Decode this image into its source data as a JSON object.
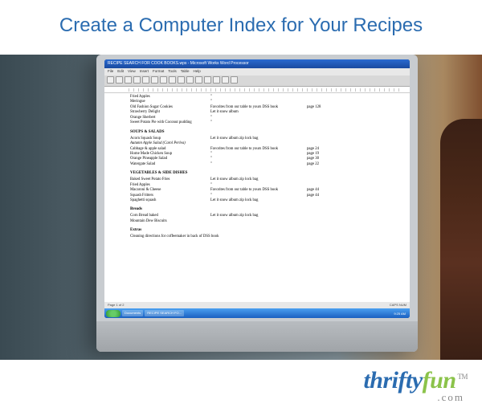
{
  "page": {
    "title": "Create a Computer Index for Your Recipes"
  },
  "logo": {
    "part1": "thrifty",
    "part2": "fun",
    "tm": "TM",
    "domain": ".com"
  },
  "word": {
    "titlebar": "RECIPE SEARCH FOR COOK BOOKS.wps - Microsoft Works Word Processor",
    "menus": [
      "File",
      "Edit",
      "View",
      "Insert",
      "Format",
      "Tools",
      "Table",
      "Help"
    ],
    "status_left": "Page 1 of 2",
    "status_right": "CAPS NUM",
    "taskbar": {
      "doc_item": "Documents",
      "app_item": "RECIPE SEARCH FO...",
      "clock": "9:25 AM"
    }
  },
  "doc": {
    "top_rows": [
      {
        "name": "Fried Apples",
        "src": "\"",
        "pg": ""
      },
      {
        "name": "Meringue",
        "src": "\"",
        "pg": ""
      },
      {
        "name": "Old Fashion Sugar Cookies",
        "src": "Favorites from our table to yours DSS book",
        "pg": "page 128"
      },
      {
        "name": "Strawberry Delight",
        "src": "Let it snow album",
        "pg": ""
      },
      {
        "name": "Orange Sherbert",
        "src": "\"",
        "pg": ""
      },
      {
        "name": "Sweet Potato Pie with Coconut pudding",
        "src": "\"",
        "pg": ""
      }
    ],
    "sections": [
      {
        "head": "SOUPS & SALADS",
        "rows": [
          {
            "name": "Acorn Squash Soup",
            "src": "Let it snow album zip lock bag",
            "pg": ""
          },
          {
            "name": "Autumn Apple Salad  (Carol Perlea)",
            "ital": true,
            "src": "",
            "pg": ""
          },
          {
            "name": "Cabbage & apple salad",
            "src": "Favorites from our table to yours DSS book",
            "pg": "page 24"
          },
          {
            "name": "Home Made Chicken Soup",
            "src": "\"",
            "pg": "page 19"
          },
          {
            "name": "Orange Pineapple Salad",
            "src": "\"",
            "pg": "page 30"
          },
          {
            "name": "Watergate Salad",
            "src": "\"",
            "pg": "page 22"
          }
        ]
      },
      {
        "head": "VEGETABLES & SIDE DISHES",
        "rows": [
          {
            "name": "Baked Sweet Potato Fries",
            "src": "Let it snow album zip lock bag",
            "pg": ""
          },
          {
            "name": "Fried Apples",
            "src": "\"",
            "pg": ""
          },
          {
            "name": "Macaroni & Cheese",
            "src": "Favorites from our table to yours DSS book",
            "pg": "page 44"
          },
          {
            "name": "Squash Fritters",
            "src": "\"",
            "pg": "page 44"
          },
          {
            "name": "Spaghetti squash",
            "src": "Let it snow album zip lock bag",
            "pg": ""
          }
        ]
      },
      {
        "head": "Breads",
        "rows": [
          {
            "name": "Corn Bread baked",
            "src": "Let it snow album zip lock bag",
            "pg": ""
          },
          {
            "name": "Mountain Dew Biscuits",
            "src": "",
            "pg": ""
          }
        ]
      },
      {
        "head": "Extras",
        "rows": [
          {
            "name": "Cleaning directions for coffeemaker in back of DSS book",
            "src": "",
            "pg": ""
          }
        ]
      }
    ]
  }
}
